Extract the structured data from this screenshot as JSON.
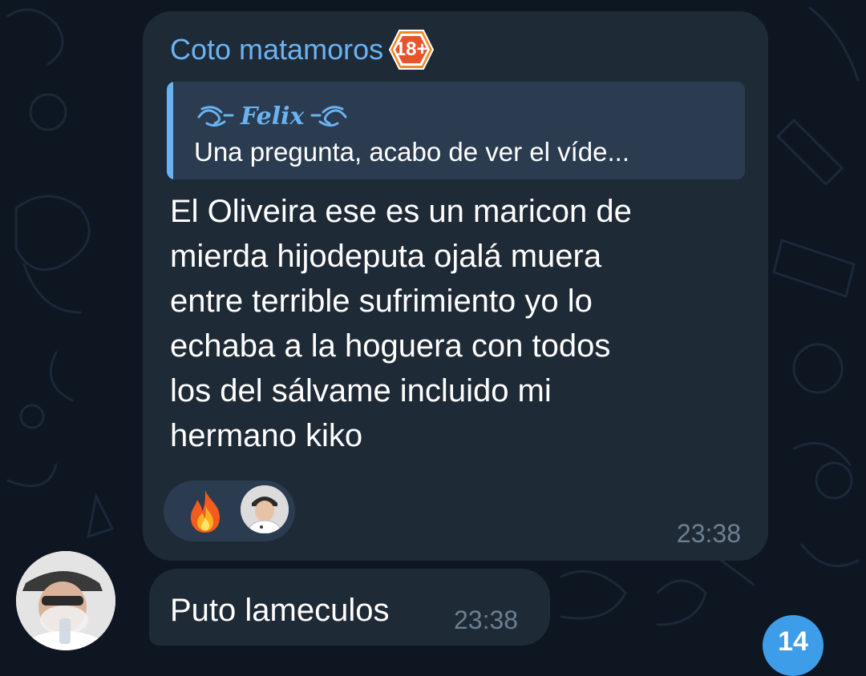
{
  "theme": {
    "background": "#0e1621",
    "bubble": "#1f2a37",
    "accent": "#6ab3f3",
    "reply_bg": "#2b3c50",
    "timestamp": "#6d7f8f",
    "badge": "#3e9de8"
  },
  "message": {
    "sender": "Coto matamoros",
    "sender_badge": "18+",
    "reply": {
      "author": "Felix",
      "text": "Una pregunta, acabo de ver el víde..."
    },
    "lines": [
      "El Oliveira ese es un maricon de",
      "mierda hijodeputa ojalá muera",
      "entre terrible sufrimiento yo lo",
      "echaba a la hoguera con todos",
      "los del sálvame incluido mi",
      "hermano kiko"
    ],
    "reactions": [
      {
        "icon": "fire-emoji"
      },
      {
        "icon": "user-avatar-reaction"
      }
    ],
    "time": "23:38"
  },
  "second_message": {
    "text": "Puto lameculos",
    "time": "23:38"
  },
  "unread_count": "14"
}
